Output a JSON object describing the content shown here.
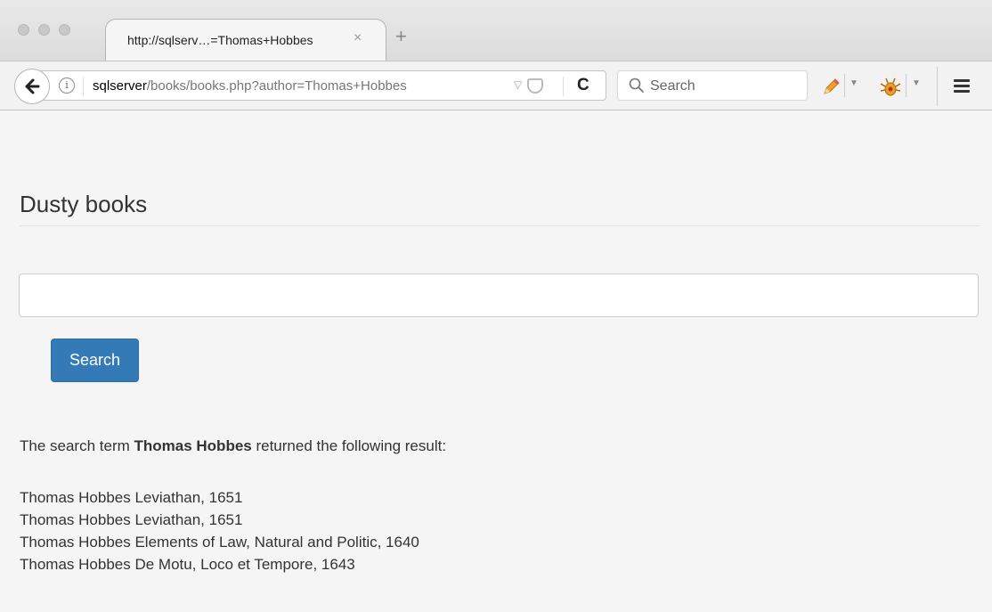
{
  "browser": {
    "tab_title": "http://sqlserv…=Thomas+Hobbes",
    "tab_close": "×",
    "new_tab": "+",
    "url_host": "sqlserver",
    "url_path": "/books/books.php?author=Thomas+Hobbes",
    "search_placeholder": "Search"
  },
  "page": {
    "title": "Dusty books",
    "search_input_value": "",
    "search_button_label": "Search",
    "result_prefix": "The search term ",
    "result_term": "Thomas Hobbes",
    "result_suffix": " returned the following result:",
    "results": [
      "Thomas Hobbes Leviathan, 1651",
      "Thomas Hobbes Leviathan, 1651",
      "Thomas Hobbes Elements of Law, Natural and Politic, 1640",
      "Thomas Hobbes De Motu, Loco et Tempore, 1643"
    ]
  },
  "colors": {
    "primary_button": "#337ab7",
    "page_background": "#f5f5f5"
  }
}
